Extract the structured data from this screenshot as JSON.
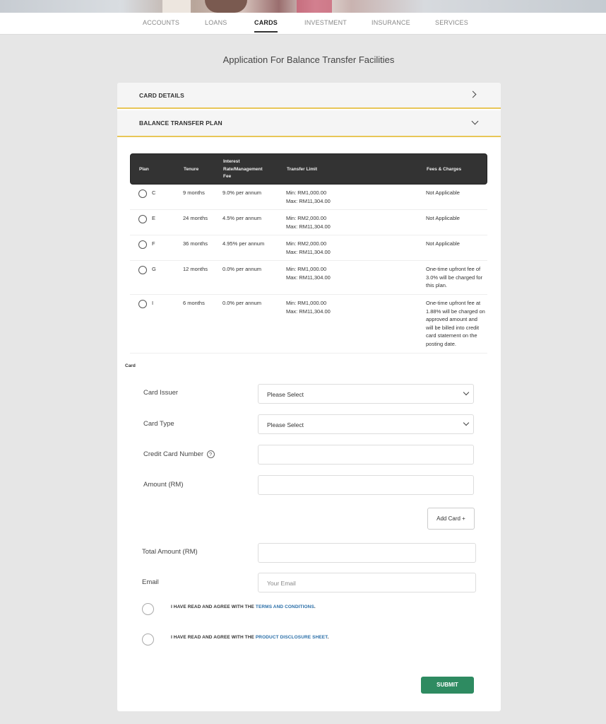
{
  "nav": {
    "items": [
      "ACCOUNTS",
      "LOANS",
      "CARDS",
      "INVESTMENT",
      "INSURANCE",
      "SERVICES"
    ]
  },
  "page": {
    "title": "Application For Balance Transfer Facilities"
  },
  "accordion": {
    "card_details": "CARD DETAILS",
    "balance_transfer_plan": "BALANCE TRANSFER PLAN"
  },
  "plan_table": {
    "headers": {
      "plan": "Plan",
      "tenure": "Tenure",
      "interest_l1": "Interest",
      "interest_l2": "Rate/Management",
      "interest_l3": "Fee",
      "limit": "Transfer Limit",
      "fees": "Fees & Charges"
    },
    "rows": [
      {
        "plan": "C",
        "tenure": "9 months",
        "rate": "9.0% per annum",
        "min": "Min: RM1,000.00",
        "max": "Max: RM11,304.00",
        "fees": [
          "Not Applicable"
        ]
      },
      {
        "plan": "E",
        "tenure": "24 months",
        "rate": "4.5% per annum",
        "min": "Min: RM2,000.00",
        "max": "Max: RM11,304.00",
        "fees": [
          "Not Applicable"
        ]
      },
      {
        "plan": "F",
        "tenure": "36 months",
        "rate": "4.95% per annum",
        "min": "Min: RM2,000.00",
        "max": "Max: RM11,304.00",
        "fees": [
          "Not Applicable"
        ]
      },
      {
        "plan": "G",
        "tenure": "12 months",
        "rate": "0.0% per annum",
        "min": "Min: RM1,000.00",
        "max": "Max: RM11,304.00",
        "fees": [
          "One-time upfront fee of",
          "3.0% will be charged for",
          "this plan."
        ]
      },
      {
        "plan": "I",
        "tenure": "6 months",
        "rate": "0.0% per annum",
        "min": "Min: RM1,000.00",
        "max": "Max: RM11,304.00",
        "fees": [
          "One-time upfront fee at",
          "1.88% will be charged on",
          "approved amount and",
          "will be billed into credit",
          "card statement on the",
          "posting date."
        ]
      }
    ]
  },
  "card_form": {
    "section_label": "Card",
    "card_issuer": {
      "label": "Card Issuer",
      "value": "Please Select"
    },
    "card_type": {
      "label": "Card Type",
      "value": "Please Select"
    },
    "card_number": {
      "label": "Credit Card Number",
      "help": "?",
      "value": ""
    },
    "amount": {
      "label": "Amount (RM)",
      "value": ""
    },
    "add_card": "Add Card +"
  },
  "summary": {
    "total_amount": {
      "label": "Total Amount (RM)",
      "value": ""
    },
    "email": {
      "label": "Email",
      "placeholder": "Your Email"
    }
  },
  "agreements": {
    "terms": {
      "text": "I HAVE READ AND AGREE WITH THE ",
      "link": "TERMS AND CONDITIONS",
      "suffix": "."
    },
    "pds": {
      "text": "I HAVE READ AND AGREE WITH THE ",
      "link": "PRODUCT DISCLOSURE SHEET",
      "suffix": "."
    }
  },
  "submit_label": "SUBMIT",
  "colors": {
    "accent": "#e8c658",
    "submit": "#2e8b61",
    "link": "#2b6fa8",
    "table_header": "#333333"
  }
}
